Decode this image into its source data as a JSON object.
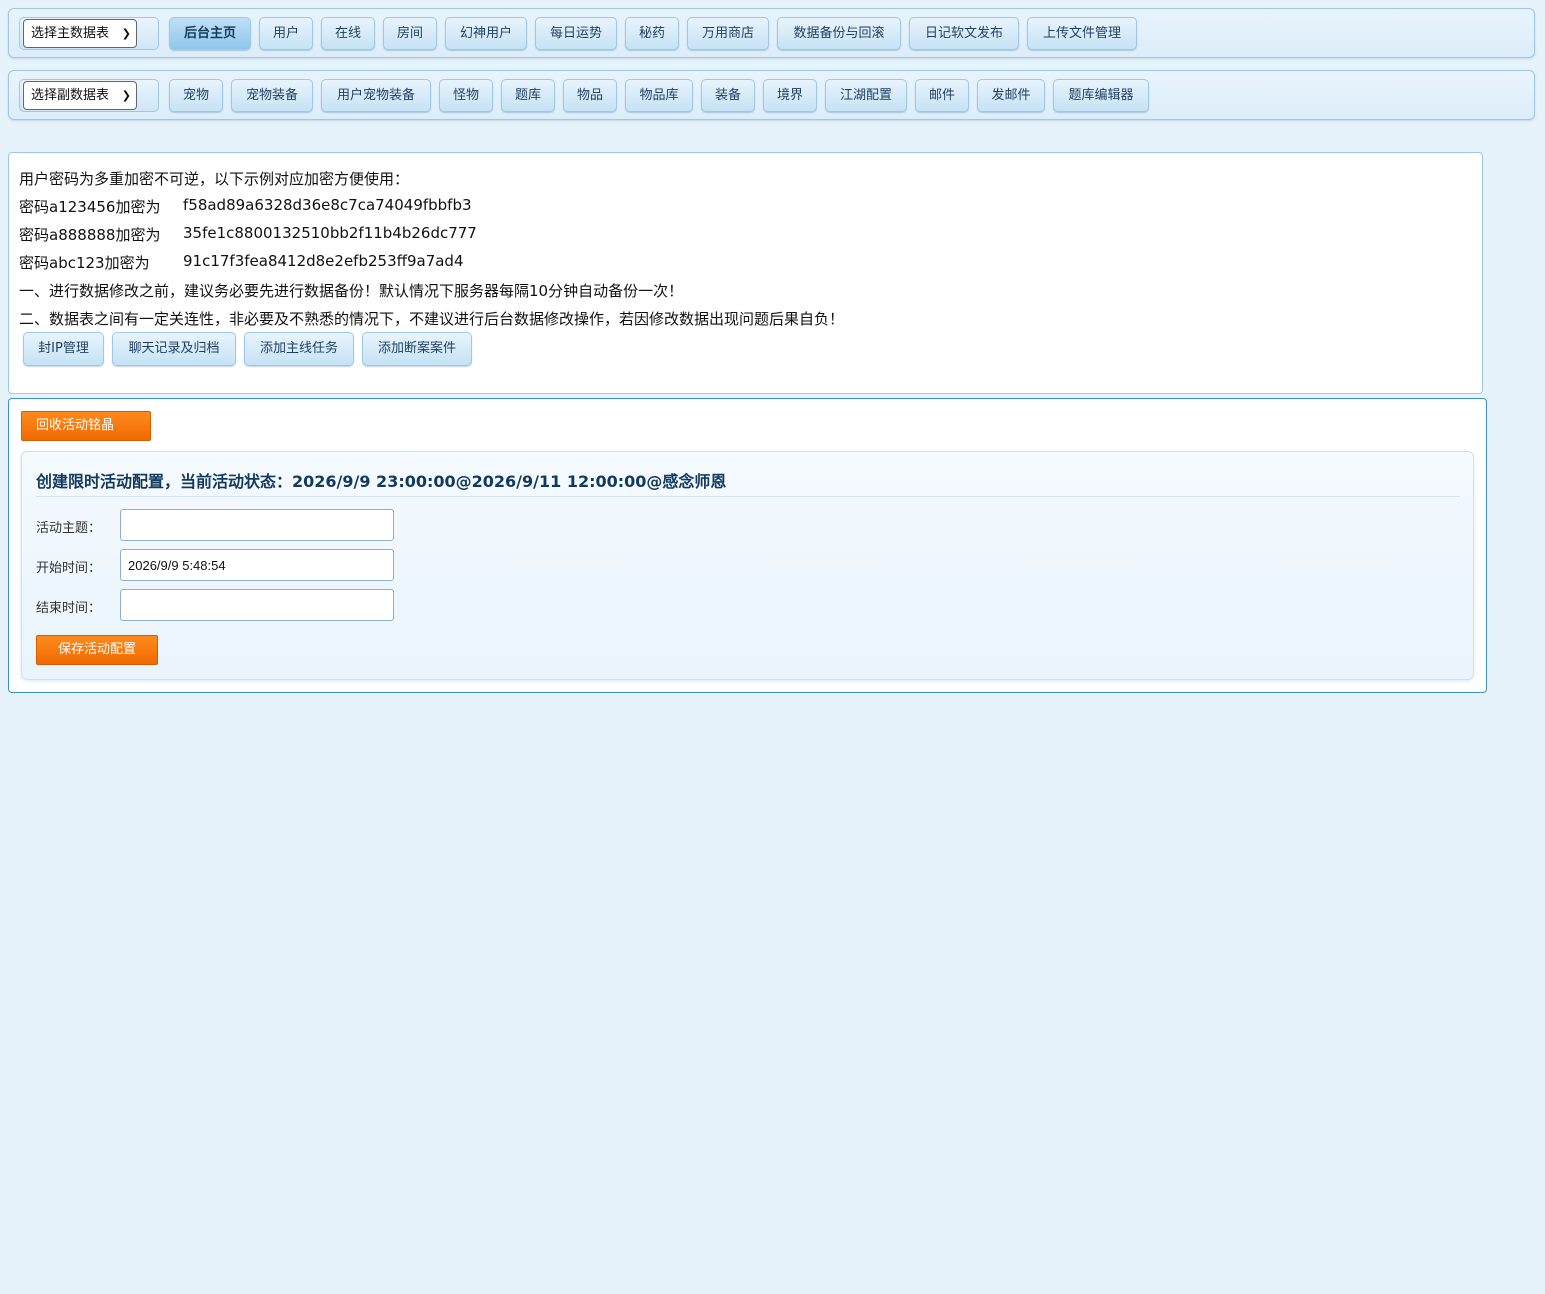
{
  "nav_primary": {
    "select_label": "选择主数据表",
    "buttons": [
      "后台主页",
      "用户",
      "在线",
      "房间",
      "幻神用户",
      "每日运势",
      "秘药",
      "万用商店",
      "数据备份与回滚",
      "日记软文发布",
      "上传文件管理"
    ]
  },
  "nav_secondary": {
    "select_label": "选择副数据表",
    "buttons": [
      "宠物",
      "宠物装备",
      "用户宠物装备",
      "怪物",
      "题库",
      "物品",
      "物品库",
      "装备",
      "境界",
      "江湖配置",
      "邮件",
      "发邮件",
      "题库编辑器"
    ]
  },
  "info": {
    "intro": "用户密码为多重加密不可逆，以下示例对应加密方便使用：",
    "examples": [
      {
        "label": "密码a123456加密为",
        "hash": "f58ad89a6328d36e8c7ca74049fbbfb3"
      },
      {
        "label": "密码a888888加密为",
        "hash": "35fe1c8800132510bb2f11b4b26dc777"
      },
      {
        "label": "密码abc123加密为",
        "hash": "91c17f3fea8412d8e2efb253ff9a7ad4"
      }
    ],
    "notice1": "一、进行数据修改之前，建议务必要先进行数据备份！默认情况下服务器每隔10分钟自动备份一次！",
    "notice2": "二、数据表之间有一定关连性，非必要及不熟悉的情况下，不建议进行后台数据修改操作，若因修改数据出现问题后果自负！",
    "tools": [
      "封IP管理",
      "聊天记录及归档",
      "添加主线任务",
      "添加断案案件"
    ]
  },
  "activity": {
    "recycle_button": "回收活动铭晶",
    "title": "创建限时活动配置，当前活动状态：2026/9/9 23:00:00@2026/9/11 12:00:00@感念师恩",
    "fields": [
      {
        "label": "活动主题：",
        "value": ""
      },
      {
        "label": "开始时间：",
        "value": "2026/9/9 5:48:54"
      },
      {
        "label": "结束时间：",
        "value": ""
      }
    ],
    "save_button": "保存活动配置"
  }
}
